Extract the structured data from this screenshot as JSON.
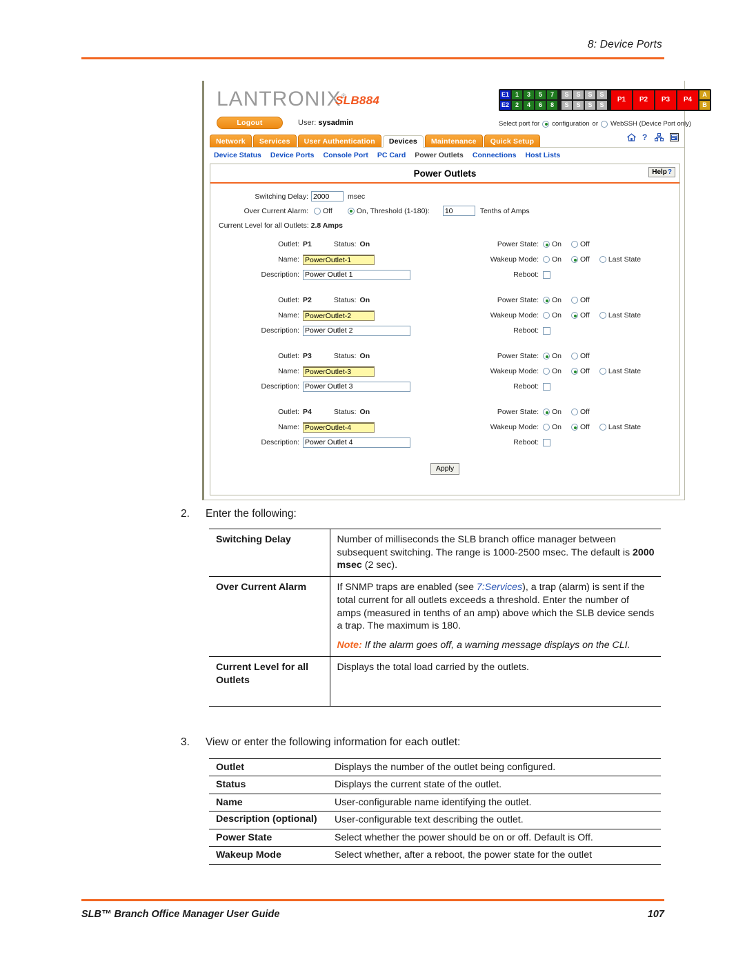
{
  "page": {
    "header_title": "8: Device Ports",
    "footer_title": "SLB™ Branch Office Manager User Guide",
    "footer_page": "107",
    "accent_color": "#F26722"
  },
  "screenshot": {
    "brand": "LANTRONIX",
    "brand_reg": "®",
    "model": "SLB884",
    "logout_label": "Logout",
    "user_label": "User:",
    "user_name": "sysadmin",
    "portmap": {
      "eth": [
        "E1",
        "E2"
      ],
      "num_top": [
        "1",
        "3",
        "5",
        "7"
      ],
      "num_bottom": [
        "2",
        "4",
        "6",
        "8"
      ],
      "serial": [
        "S",
        "S",
        "S",
        "S"
      ],
      "power": [
        "P1",
        "P2",
        "P3",
        "P4"
      ],
      "ab": [
        "A",
        "B"
      ],
      "colors": {
        "eth": "#0b22c4",
        "numbered": "#1f7a1f",
        "serial": "#b5b5b5",
        "power": "#f00000",
        "ab": "#D4A017"
      }
    },
    "select_port": {
      "prefix": "Select port for",
      "option_configuration": "configuration",
      "or": "or",
      "option_webssh": "WebSSH (Device Port only)",
      "selected": "configuration"
    },
    "tabs": [
      {
        "label": "Network",
        "active": false
      },
      {
        "label": "Services",
        "active": false
      },
      {
        "label": "User Authentication",
        "active": false
      },
      {
        "label": "Devices",
        "active": true
      },
      {
        "label": "Maintenance",
        "active": false
      },
      {
        "label": "Quick Setup",
        "active": false
      }
    ],
    "nav_icons": [
      "home-icon",
      "help-icon",
      "sitemap-icon",
      "logs-icon"
    ],
    "subnav": [
      {
        "label": "Device Status",
        "current": false
      },
      {
        "label": "Device Ports",
        "current": false
      },
      {
        "label": "Console Port",
        "current": false
      },
      {
        "label": "PC Card",
        "current": false
      },
      {
        "label": "Power Outlets",
        "current": true
      },
      {
        "label": "Connections",
        "current": false
      },
      {
        "label": "Host Lists",
        "current": false
      }
    ],
    "panel": {
      "title": "Power Outlets",
      "help_label": "Help",
      "help_mark": "?",
      "switching_delay": {
        "label": "Switching Delay:",
        "value": "2000",
        "unit": "msec"
      },
      "over_current_alarm": {
        "label": "Over Current Alarm:",
        "off_label": "Off",
        "on_label": "On, Threshold (1-180):",
        "selected": "on",
        "threshold_value": "10",
        "unit": "Tenths of Amps"
      },
      "current_level": {
        "label": "Current Level for all Outlets:",
        "value": "2.8 Amps"
      },
      "field_labels": {
        "outlet": "Outlet:",
        "status": "Status:",
        "name": "Name:",
        "description": "Description:",
        "power_state": "Power State:",
        "wakeup_mode": "Wakeup Mode:",
        "reboot": "Reboot:",
        "on": "On",
        "off": "Off",
        "last_state": "Last State"
      },
      "outlets": [
        {
          "id": "P1",
          "status": "On",
          "name": "PowerOutlet-1",
          "description": "Power Outlet 1",
          "power_state": "On",
          "wakeup_mode": "Off",
          "reboot": false
        },
        {
          "id": "P2",
          "status": "On",
          "name": "PowerOutlet-2",
          "description": "Power Outlet 2",
          "power_state": "On",
          "wakeup_mode": "Off",
          "reboot": false
        },
        {
          "id": "P3",
          "status": "On",
          "name": "PowerOutlet-3",
          "description": "Power Outlet 3",
          "power_state": "On",
          "wakeup_mode": "Off",
          "reboot": false
        },
        {
          "id": "P4",
          "status": "On",
          "name": "PowerOutlet-4",
          "description": "Power Outlet 4",
          "power_state": "On",
          "wakeup_mode": "Off",
          "reboot": false
        }
      ],
      "apply_label": "Apply"
    }
  },
  "steps": [
    {
      "num": "2.",
      "text": "Enter the following:"
    },
    {
      "num": "3.",
      "text": "View or enter the following information for each outlet:"
    }
  ],
  "table_enter": [
    {
      "key": "Switching Delay",
      "value_pre": "Number of milliseconds the SLB branch office manager between subsequent switching. The range is 1000-2500 msec. The default is ",
      "value_bold": "2000 msec",
      "value_post": " (2 sec)."
    },
    {
      "key": "Over Current Alarm",
      "value_pre": "If SNMP traps are enabled (see ",
      "value_link": "7:Services",
      "value_post": "), a trap (alarm) is sent if the total current for all outlets exceeds a threshold. Enter the number of amps (measured in tenths of an amp) above which the SLB device sends a trap. The maximum is 180.",
      "note_label": "Note:",
      "note_text": " If the alarm goes off, a warning message displays on the CLI."
    },
    {
      "key": "Current Level for all Outlets",
      "value_post": "Displays the total load carried by the outlets."
    }
  ],
  "table_outlet": [
    {
      "key": "Outlet",
      "value": "Displays the number of the outlet being configured."
    },
    {
      "key": "Status",
      "value": "Displays the current state of the outlet."
    },
    {
      "key": "Name",
      "value": "User-configurable name identifying the outlet."
    },
    {
      "key": "Description (optional)",
      "value": "User-configurable text describing the outlet."
    },
    {
      "key": "Power State",
      "value": "Select whether the power should be on or off. Default is Off."
    },
    {
      "key": "Wakeup Mode",
      "value": "Select whether, after a reboot, the power state for the outlet"
    }
  ]
}
